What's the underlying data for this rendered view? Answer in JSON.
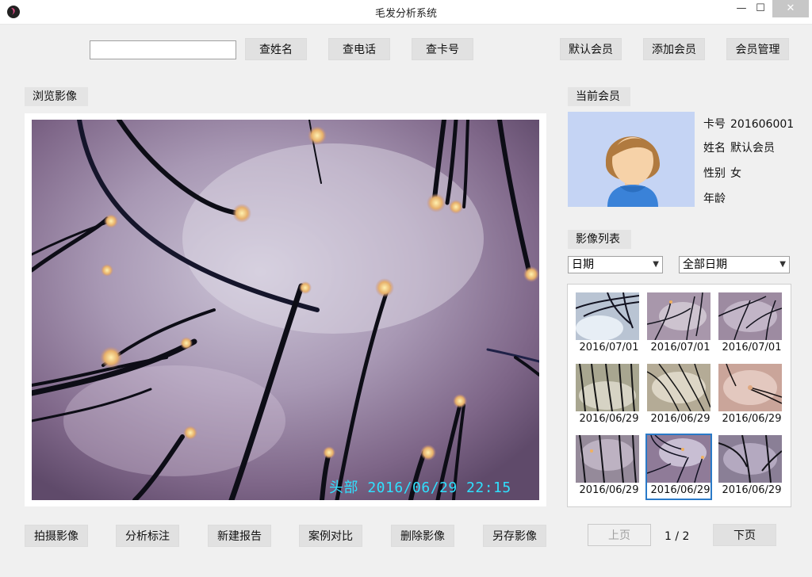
{
  "window": {
    "title": "毛发分析系统",
    "minimize": "—",
    "maximize": "☐",
    "close": "✕"
  },
  "toolbar": {
    "search_placeholder": "",
    "by_name": "查姓名",
    "by_phone": "查电话",
    "by_card": "查卡号",
    "default_member": "默认会员",
    "add_member": "添加会员",
    "member_mgmt": "会员管理"
  },
  "browse": {
    "label": "浏览影像",
    "caption": "头部  2016/06/29 22:15"
  },
  "member": {
    "label": "当前会员",
    "card_label": "卡号",
    "card_value": "201606001",
    "name_label": "姓名",
    "name_value": "默认会员",
    "gender_label": "性别",
    "gender_value": "女",
    "age_label": "年龄",
    "age_value": ""
  },
  "images": {
    "label": "影像列表",
    "filter_field": "日期",
    "filter_range": "全部日期",
    "thumbs": [
      {
        "date": "2016/07/01"
      },
      {
        "date": "2016/07/01"
      },
      {
        "date": "2016/07/01"
      },
      {
        "date": "2016/06/29"
      },
      {
        "date": "2016/06/29"
      },
      {
        "date": "2016/06/29"
      },
      {
        "date": "2016/06/29"
      },
      {
        "date": "2016/06/29"
      },
      {
        "date": "2016/06/29"
      }
    ],
    "selected_index": 7
  },
  "actions": {
    "capture": "拍摄影像",
    "annotate": "分析标注",
    "new_report": "新建报告",
    "compare": "案例对比",
    "delete": "删除影像",
    "save_as": "另存影像"
  },
  "pager": {
    "prev": "上页",
    "next": "下页",
    "current": "1",
    "sep": "/",
    "total": "2"
  },
  "colors": {
    "caption": "#2fe0ff",
    "avatar_bg": "#c5d4f4",
    "selected": "#2a7ac8"
  }
}
